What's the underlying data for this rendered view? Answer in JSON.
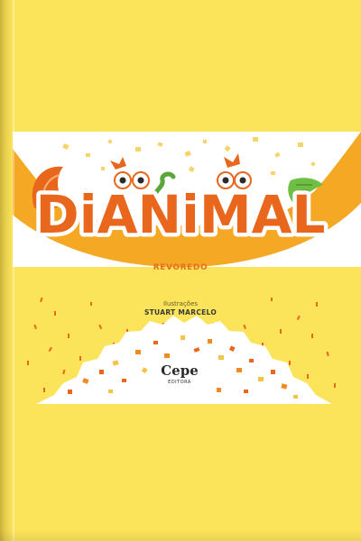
{
  "cover": {
    "title": "DiANiMAL",
    "author": "REVOREDO",
    "illustrations_label": "Ilustrações",
    "illustrator": "STUART MARCELO",
    "publisher": "Cepe",
    "publisher_sub": "EDITORA"
  },
  "colors": {
    "background": "#fbe35a",
    "orange": "#f08a22",
    "white_band": "#ffffff",
    "title_fill": "#e8671d",
    "green": "#5aa63a"
  }
}
